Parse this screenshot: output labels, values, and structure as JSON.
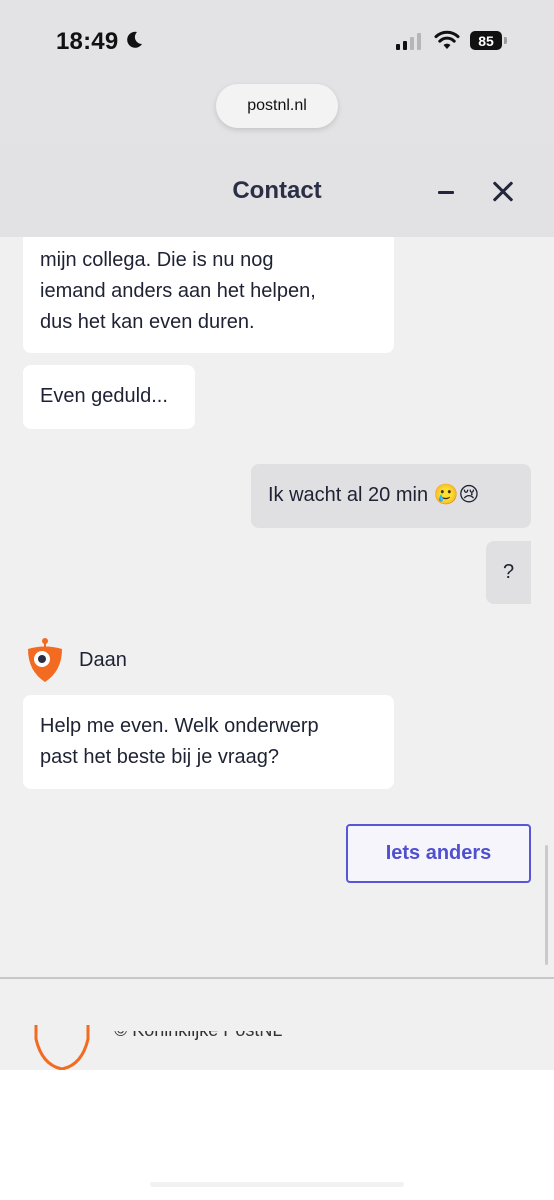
{
  "status_bar": {
    "time": "18:49",
    "battery": "85"
  },
  "browser": {
    "url": "postnl.nl"
  },
  "chat": {
    "title": "Contact",
    "messages": {
      "old_line_1": "mijn collega. Die is nu nog",
      "old_line_2": "iemand anders aan het helpen,",
      "old_line_3": "dus het kan even duren.",
      "wait": "Even geduld...",
      "user_1": "Ik wacht al 20 min 🥲😢",
      "user_2": "?",
      "help_line_1": "Help me even. Welk onderwerp",
      "help_line_2": "past het beste bij je vraag?"
    },
    "agent_name": "Daan",
    "option_button": "Iets anders"
  },
  "footer": {
    "copyright": "© Koninklijke PostNL"
  },
  "colors": {
    "accent": "#5656d6",
    "brand_orange": "#f26b21",
    "header_bg": "#e2e2e4",
    "panel_bg": "#f0f0f1"
  },
  "icons": {
    "moon": "moon-icon",
    "signal": "cellular-signal-icon",
    "wifi": "wifi-icon",
    "battery": "battery-icon",
    "minimize": "minimize-icon",
    "close": "close-icon",
    "avatar": "daan-robot-avatar"
  }
}
